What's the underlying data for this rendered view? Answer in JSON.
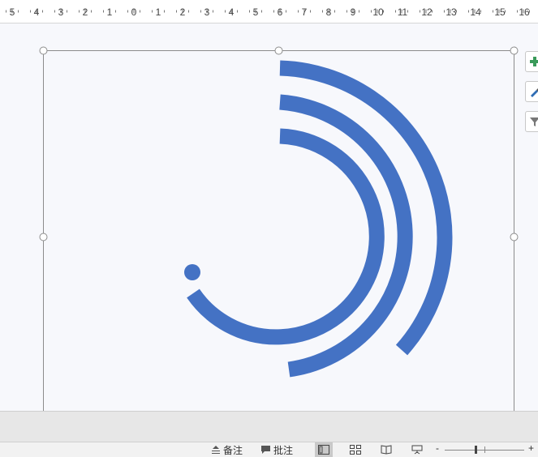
{
  "ruler": {
    "labels": [
      "5",
      "4",
      "3",
      "2",
      "1",
      "0",
      "1",
      "2",
      "3",
      "4",
      "5",
      "6",
      "7",
      "8",
      "9",
      "10",
      "11",
      "12",
      "13",
      "14",
      "15",
      "16"
    ]
  },
  "side_tools": {
    "icons": [
      "add-element-icon",
      "style-brush-icon",
      "filter-icon"
    ]
  },
  "colors": {
    "arc": "#4472c4",
    "selection": "#8c8c8c",
    "add_green": "#3a9a5a"
  },
  "status_bar": {
    "notes_label": "备注",
    "comments_label": "批注",
    "zoom_minus": "-",
    "zoom_plus": "+"
  }
}
